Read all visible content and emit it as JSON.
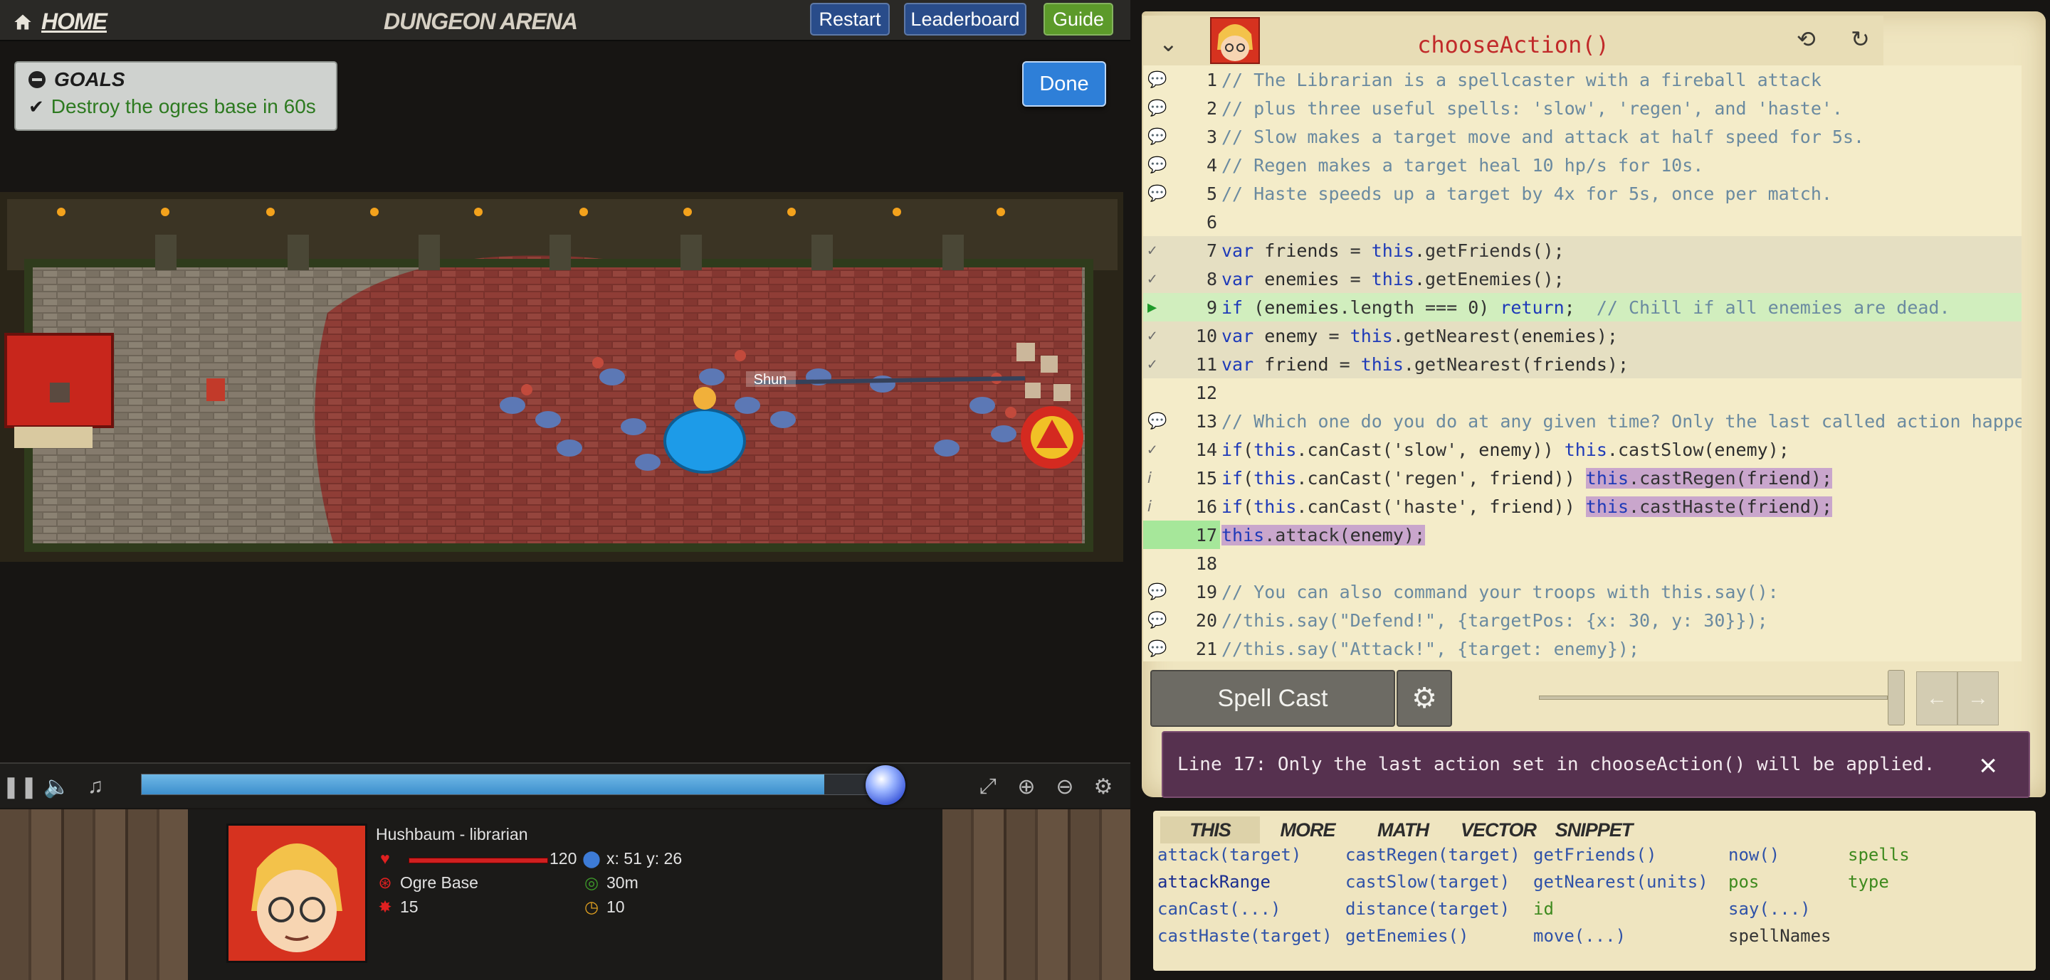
{
  "topbar": {
    "home_label": "HOME",
    "arena_title": "DUNGEON ARENA",
    "restart_label": "Restart",
    "leaderboard_label": "Leaderboard",
    "guide_label": "Guide"
  },
  "goals": {
    "header": "GOALS",
    "items": [
      "Destroy the ogres base in 60s"
    ]
  },
  "done_label": "Done",
  "map": {
    "hero_nameplate": "Shun"
  },
  "playback": {
    "progress_fraction": 0.915
  },
  "hud": {
    "unit_name": "Hushbaum - librarian",
    "health": "120",
    "target": "Ogre Base",
    "attack_damage": "15",
    "position": "x: 51 y: 26",
    "range": "30m",
    "speed": "10"
  },
  "editor": {
    "method_title": "chooseAction()",
    "lines": [
      {
        "n": "1",
        "text": "// The Librarian is a spellcaster with a fireball attack"
      },
      {
        "n": "2",
        "text": "// plus three useful spells: 'slow', 'regen', and 'haste'."
      },
      {
        "n": "3",
        "text": "// Slow makes a target move and attack at half speed for 5s."
      },
      {
        "n": "4",
        "text": "// Regen makes a target heal 10 hp/s for 10s."
      },
      {
        "n": "5",
        "text": "// Haste speeds up a target by 4x for 5s, once per match."
      },
      {
        "n": "6",
        "text": ""
      },
      {
        "n": "7",
        "text": "var friends = this.getFriends();"
      },
      {
        "n": "8",
        "text": "var enemies = this.getEnemies();"
      },
      {
        "n": "9",
        "text": "if (enemies.length === 0) return;  // Chill if all enemies are dead."
      },
      {
        "n": "10",
        "text": "var enemy = this.getNearest(enemies);"
      },
      {
        "n": "11",
        "text": "var friend = this.getNearest(friends);"
      },
      {
        "n": "12",
        "text": ""
      },
      {
        "n": "13",
        "text": "// Which one do you do at any given time? Only the last called action happens."
      },
      {
        "n": "14",
        "text": "if(this.canCast('slow', enemy)) this.castSlow(enemy);"
      },
      {
        "n": "15",
        "text": "if(this.canCast('regen', friend)) this.castRegen(friend);"
      },
      {
        "n": "16",
        "text": "if(this.canCast('haste', friend)) this.castHaste(friend);"
      },
      {
        "n": "17",
        "text": "this.attack(enemy);"
      },
      {
        "n": "18",
        "text": ""
      },
      {
        "n": "19",
        "text": "// You can also command your troops with this.say():"
      },
      {
        "n": "20",
        "text": "//this.say(\"Defend!\", {targetPos: {x: 30, y: 30}});"
      },
      {
        "n": "21",
        "text": "//this.say(\"Attack!\", {target: enemy});"
      }
    ]
  },
  "cast": {
    "spell_cast_label": "Spell Cast"
  },
  "message": {
    "text": "Line 17: Only the last action set in chooseAction() will be applied."
  },
  "docs": {
    "tabs": [
      "THIS",
      "MORE",
      "MATH",
      "VECTOR",
      "SNIPPET"
    ],
    "col1": [
      "attack(target)",
      "attackRange",
      "canCast(...)",
      "castHaste(target)"
    ],
    "col2": [
      "castRegen(target)",
      "castSlow(target)",
      "distance(target)",
      "getEnemies()"
    ],
    "col3": [
      "getFriends()",
      "getNearest(units)",
      "id",
      "move(...)"
    ],
    "col4": [
      "now()",
      "pos",
      "say(...)",
      "spellNames"
    ],
    "col5": [
      "spells",
      "type"
    ]
  },
  "colors": {
    "accent_blue": "#294c8a",
    "guide_green": "#5c9a2a",
    "message_bg": "#56314f",
    "title_red": "#c12a2a"
  }
}
